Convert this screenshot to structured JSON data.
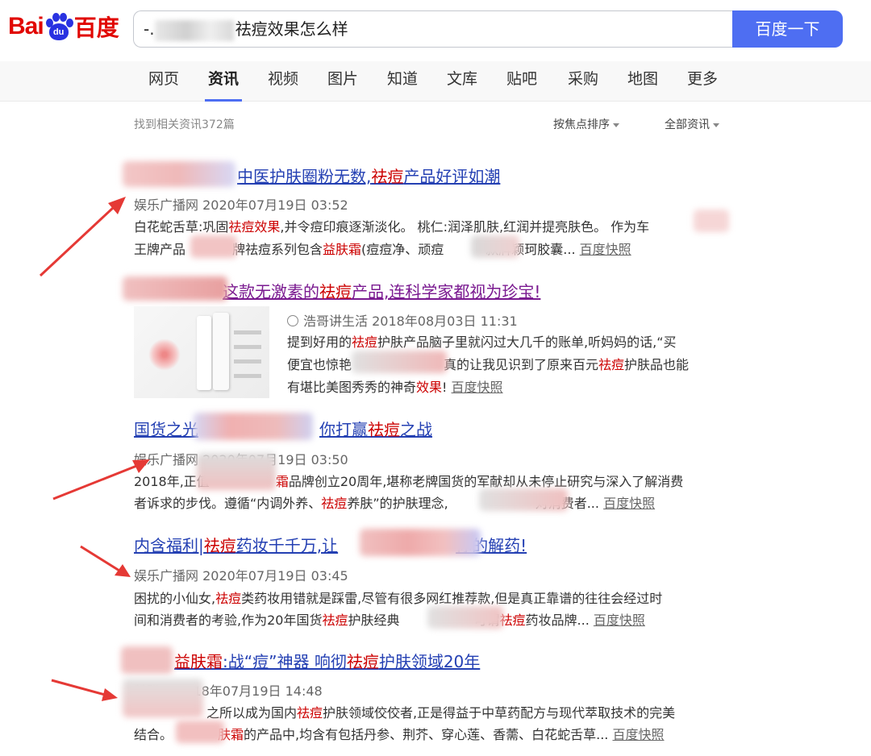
{
  "header": {
    "logo_bai": "Bai",
    "logo_du": "du",
    "logo_cn": "百度",
    "search_value": "祛痘效果怎么样",
    "search_prefix": "-.",
    "search_button": "百度一下"
  },
  "tabs": [
    "网页",
    "资讯",
    "视频",
    "图片",
    "知道",
    "文库",
    "贴吧",
    "采购",
    "地图",
    "更多"
  ],
  "active_tab": "资讯",
  "summary": {
    "found": "找到相关资讯372篇",
    "sort": "按焦点排序",
    "filter": "全部资讯"
  },
  "results": [
    {
      "title": {
        "a": "中医护肤圈粉无数,",
        "b": "祛痘",
        "c": "产品好评如潮"
      },
      "meta": "娱乐广播网   2020年07月19日 03:52",
      "l1": {
        "a": "白花蛇舌草:巩固",
        "b": "祛痘效果",
        "c": ",并令痘印痕逐渐淡化。 桃仁:润泽肌肤,红润并提亮肤色。 作为车"
      },
      "l2": {
        "a": "王牌产品",
        "b": "牌祛痘系列包含",
        "c": "益肤霜",
        "d": "(痘痘净、顽痘",
        "e": "款牌颖珂胶囊... ",
        "snap": "百度快照"
      }
    },
    {
      "title": {
        "a": "这款无激素的",
        "b": "祛痘",
        "c": "产品,连科学家都视为珍宝!"
      },
      "meta": "浩哥讲生活   2018年08月03日 11:31",
      "l1": {
        "a": "提到好用的",
        "b": "祛痘",
        "c": "护肤产品脑子里就闪过大几千的账单,听妈妈的话,“买"
      },
      "l2": {
        "a": "便宜也惊艳",
        "b": "真的让我见识到了原来百元",
        "c": "祛痘",
        "d": "护肤品也能"
      },
      "l3": {
        "a": "有堪比美图秀秀的神奇",
        "b": "效果",
        "c": "! ",
        "snap": "百度快照"
      }
    },
    {
      "title": {
        "a": "国货之光",
        "b": "你打赢",
        "c": "祛痘",
        "d": "之战"
      },
      "meta": "娱乐广播网   2020年07月19日 03:50",
      "l1": {
        "a": "2018年,正值",
        "b": "霜",
        "c": "品牌创立20周年,堪称老牌国货的军献却从未停止研究与深入了解消费"
      },
      "l2": {
        "a": "者诉求的步伐。遵循“内调外养、",
        "b": "祛痘",
        "c": "养肤”的护肤理念,",
        "d": "对消费者... ",
        "snap": "百度快照"
      }
    },
    {
      "title": {
        "a": "内含福利|",
        "b": "祛痘",
        "c": "药妆千千万,让",
        "d": "你的解药!"
      },
      "meta": "娱乐广播网   2020年07月19日 03:45",
      "l1": {
        "a": "困扰的小仙女,",
        "b": "祛痘",
        "c": "类药妆用错就是踩雷,尽管有很多网红推荐款,但是真正靠谱的往往会经过时"
      },
      "l2": {
        "a": "间和消费者的考验,作为20年国货",
        "b": "祛痘",
        "c": "护肤经典",
        "d": "可谓",
        "e": "祛痘",
        "f": "药妆品牌... ",
        "snap": "百度快照"
      }
    },
    {
      "title": {
        "a": "益肤霜",
        "b": ":战“痘”神器 响彻",
        "c": "祛痘",
        "d": "护肤领域20年"
      },
      "meta": "慧聪网   2018年07月19日 14:48",
      "l1": {
        "a": "之所以成为国内",
        "b": "祛痘",
        "c": "护肤领域佼佼者,正是得益于中草药配方与现代萃取技术的完美"
      },
      "l2": {
        "a": "结合。",
        "b": "肤霜",
        "c": "的产品中,均含有包括丹参、荆芥、穿心莲、香薷、白花蛇舌草... ",
        "snap": "百度快照"
      }
    }
  ],
  "colors": {
    "brand_red": "#e10601",
    "brand_blue": "#2932e1",
    "button_blue": "#4e6ef2",
    "link": "#2440b3",
    "visited": "#7a1a90",
    "highlight": "#cc0000",
    "arrow": "#e53935"
  }
}
